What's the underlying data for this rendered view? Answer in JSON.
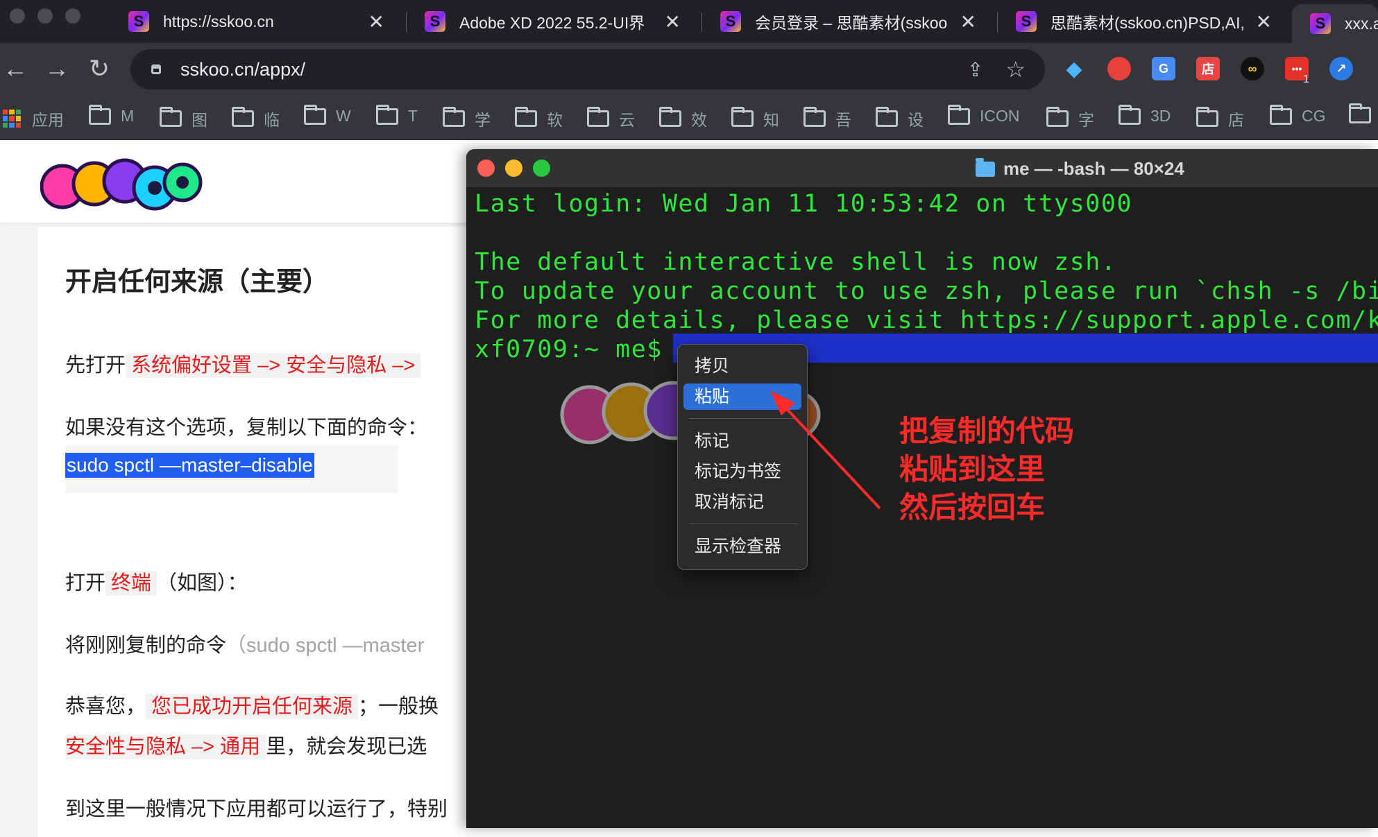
{
  "browser": {
    "tabs": [
      {
        "title": "https://sskoo.cn",
        "active": false
      },
      {
        "title": "Adobe XD 2022 55.2-UI界",
        "active": false
      },
      {
        "title": "会员登录 – 思酷素材(sskoo",
        "active": false
      },
      {
        "title": "思酷素材(sskoo.cn)PSD,AI,",
        "active": false
      },
      {
        "title": "xxx.a",
        "active": true
      }
    ],
    "address": "sskoo.cn/appx/",
    "extension_badge": "1",
    "apps_label": "应用",
    "bookmarks": [
      "M",
      "图",
      "临",
      "W",
      "T",
      "学",
      "软",
      "云",
      "效",
      "知",
      "吾",
      "设",
      "ICON",
      "字",
      "3D",
      "店",
      "CG"
    ]
  },
  "article": {
    "heading": "开启任何来源（主要）",
    "p1_prefix": "先打开",
    "p1_highlight": "系统偏好设置 –> 安全与隐私 –>",
    "p2": "如果没有这个选项，复制以下面的命令：",
    "command": "sudo spctl ––master–disable",
    "p3_prefix": "打开",
    "p3_highlight": "终端",
    "p3_suffix": "（如图）：",
    "p4_prefix": "将刚刚复制的命令",
    "p4_gray": "（sudo spctl —master",
    "p5_prefix": "恭喜您，",
    "p5_highlight": "您已成功开启任何来源",
    "p5_suffix": "；一般换",
    "p6_highlight": "安全性与隐私 –> 通用",
    "p6_suffix": "里，就会发现已选",
    "p7": "到这里一般情况下应用都可以运行了，特别"
  },
  "terminal": {
    "title": "me — -bash — 80×24",
    "lines": [
      "Last login: Wed Jan 11 10:53:42 on ttys000",
      "",
      "The default interactive shell is now zsh.",
      "To update your account to use zsh, please run `chsh -s /bin",
      "For more details, please visit https://support.apple.com/kb",
      "xf0709:~ me$"
    ],
    "menu": [
      "拷贝",
      "粘贴",
      "标记",
      "标记为书签",
      "取消标记",
      "显示检查器"
    ],
    "menu_active": "粘贴"
  },
  "annotation": {
    "lines": [
      "把复制的代码",
      "粘贴到这里",
      "然后按回车"
    ]
  },
  "colors": {
    "terminal_text": "#30e63c",
    "highlight_red": "#e31b1b",
    "selection_blue": "#1f5ef0",
    "annotation_red": "#ff2a2a"
  },
  "icons": [
    "back-arrow-icon",
    "forward-arrow-icon",
    "reload-icon",
    "lock-icon",
    "share-icon",
    "star-icon",
    "folder-icon",
    "apps-grid-icon",
    "close-icon"
  ]
}
